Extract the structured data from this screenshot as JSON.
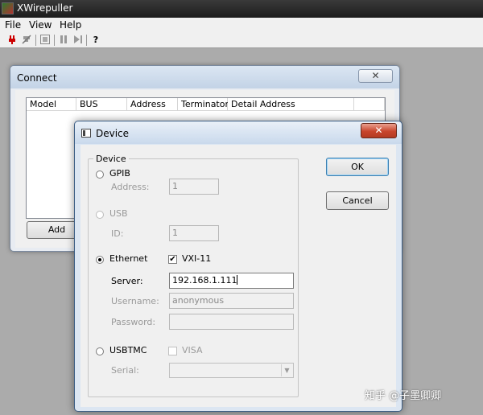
{
  "app": {
    "title": "XWirepuller"
  },
  "menu": {
    "file": "File",
    "view": "View",
    "help": "Help"
  },
  "toolbar": {
    "help_glyph": "?"
  },
  "connect": {
    "title": "Connect",
    "close_label": "✕",
    "columns": [
      "Model",
      "BUS",
      "Address",
      "Terminator",
      "Detail Address"
    ],
    "add_label": "Add"
  },
  "device": {
    "title": "Device",
    "close_label": "✕",
    "group_label": "Device",
    "gpib": {
      "label": "GPIB",
      "address_label": "Address:",
      "address_value": "1"
    },
    "usb": {
      "label": "USB",
      "id_label": "ID:",
      "id_value": "1"
    },
    "ethernet": {
      "label": "Ethernet",
      "vxi_label": "VXI-11",
      "server_label": "Server:",
      "server_value": "192.168.1.111",
      "username_label": "Username:",
      "username_value": "anonymous",
      "password_label": "Password:",
      "password_value": ""
    },
    "usbtmc": {
      "label": "USBTMC",
      "visa_label": "VISA",
      "serial_label": "Serial:",
      "serial_value": ""
    },
    "ok_label": "OK",
    "cancel_label": "Cancel"
  },
  "watermark": {
    "text": "知乎 @子墨卿卿"
  },
  "colors": {
    "desktop": "#ababab",
    "titlebar_dark": "#1c1c1c",
    "close_red": "#c8452c",
    "default_button": "#3c7fb1"
  }
}
